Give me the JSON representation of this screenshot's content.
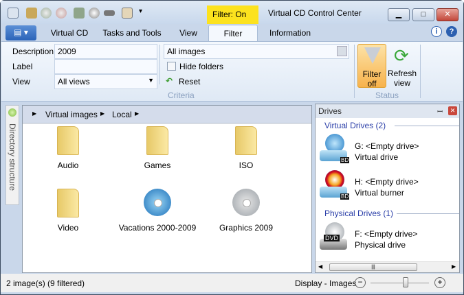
{
  "title": "Virtual CD Control Center",
  "filter_badge": "Filter: On",
  "window_controls": {
    "minimize": "▁",
    "maximize": "□",
    "close": "✕"
  },
  "tabs": [
    "Virtual CD",
    "Tasks and Tools",
    "View",
    "Filter",
    "Information"
  ],
  "active_tab": "Filter",
  "criteria": {
    "description_label": "Description",
    "description_value": "2009",
    "label_label": "Label",
    "label_value": "",
    "view_label": "View",
    "view_value": "All views",
    "images_value": "All images",
    "hide_folders": "Hide folders",
    "hide_folders_checked": false,
    "reset": "Reset",
    "group": "Criteria"
  },
  "status_group": {
    "filter_off": "Filter off",
    "refresh": "Refresh view",
    "group": "Status"
  },
  "directory_strip": "Directory structure",
  "breadcrumb": [
    "Virtual images",
    "Local"
  ],
  "items": [
    {
      "name": "Audio",
      "type": "folder"
    },
    {
      "name": "Games",
      "type": "folder"
    },
    {
      "name": "ISO",
      "type": "folder"
    },
    {
      "name": "Video",
      "type": "folder"
    },
    {
      "name": "Vacations 2000-2009",
      "type": "bluray-image"
    },
    {
      "name": "Graphics 2009",
      "type": "cd-image"
    }
  ],
  "drives_panel": {
    "title": "Drives",
    "virtual_group": "Virtual Drives (2)",
    "physical_group": "Physical Drives (1)",
    "drives": [
      {
        "line1": "G: <Empty drive>",
        "line2": "Virtual drive",
        "badge": "BD"
      },
      {
        "line1": "H: <Empty drive>",
        "line2": "Virtual burner",
        "badge": "BD"
      },
      {
        "line1": "F: <Empty drive>",
        "line2": "Physical drive",
        "badge": "DVD"
      }
    ]
  },
  "statusbar": {
    "count": "2 image(s) (9 filtered)",
    "display": "Display - Images",
    "zoom_percent": 60
  }
}
